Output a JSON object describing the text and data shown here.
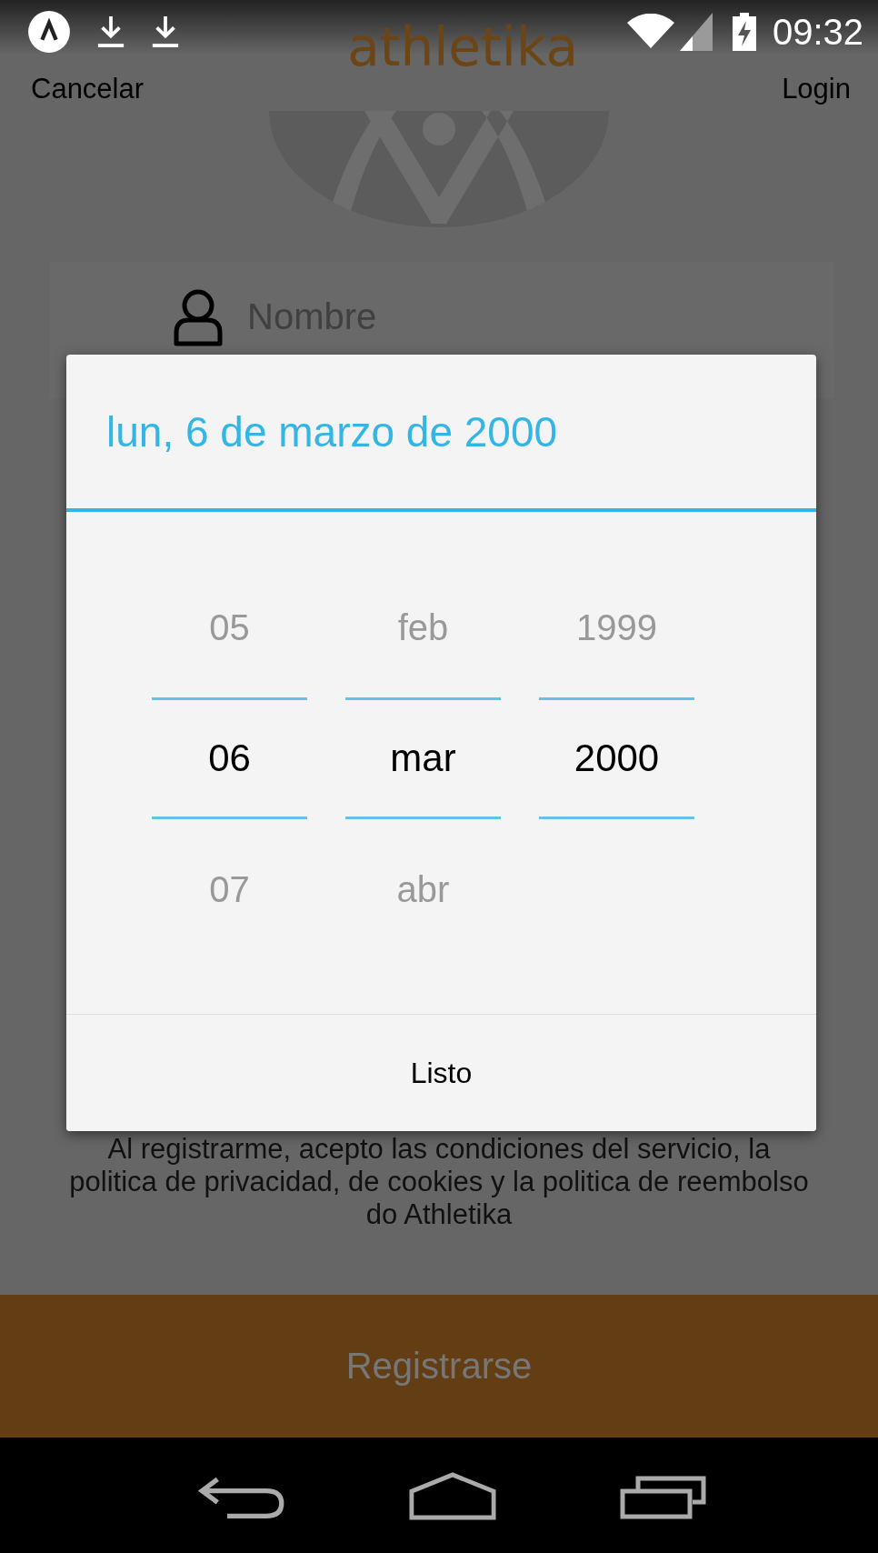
{
  "status_bar": {
    "time": "09:32"
  },
  "header": {
    "left_action": "Cancelar",
    "logo": "athletika",
    "right_action": "Login"
  },
  "name_field": {
    "placeholder": "Nombre"
  },
  "terms": "Al registrarme, acepto las condiciones del servicio, la politica de privacidad, de cookies y la politica de reembolso do Athletika",
  "register_button": "Registrarse",
  "date_dialog": {
    "title": "lun, 6 de marzo de 2000",
    "columns": [
      {
        "above": "05",
        "value": "06",
        "below": "07"
      },
      {
        "above": "feb",
        "value": "mar",
        "below": "abr"
      },
      {
        "above": "1999",
        "value": "2000"
      }
    ],
    "done_button": "Listo"
  }
}
